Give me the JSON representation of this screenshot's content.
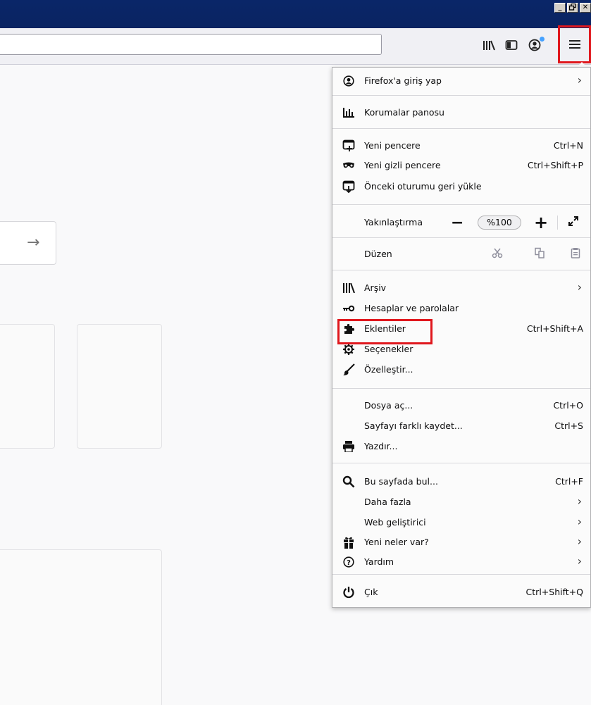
{
  "window": {
    "buttons": [
      "_",
      "🗗",
      "✕"
    ]
  },
  "toolbar": {
    "icons": [
      "library-icon",
      "sidebar-icon",
      "account-icon",
      "hamburger-menu-icon"
    ]
  },
  "menu": {
    "sign_in": "Firefox'a giriş yap",
    "protections": "Korumalar panosu",
    "new_window": "Yeni pencere",
    "new_window_sc": "Ctrl+N",
    "private_window": "Yeni gizli pencere",
    "private_window_sc": "Ctrl+Shift+P",
    "restore_session": "Önceki oturumu geri yükle",
    "zoom_label": "Yakınlaştırma",
    "zoom_minus": "−",
    "zoom_value": "%100",
    "zoom_plus": "+",
    "edit_label": "Düzen",
    "library": "Arşiv",
    "logins": "Hesaplar ve parolalar",
    "addons": "Eklentiler",
    "addons_sc": "Ctrl+Shift+A",
    "options": "Seçenekler",
    "customize": "Özelleştir...",
    "open_file": "Dosya aç...",
    "open_file_sc": "Ctrl+O",
    "save_page": "Sayfayı farklı kaydet...",
    "save_page_sc": "Ctrl+S",
    "print": "Yazdır...",
    "find": "Bu sayfada bul...",
    "find_sc": "Ctrl+F",
    "more": "Daha fazla",
    "web_dev": "Web geliştirici",
    "whats_new": "Yeni neler var?",
    "help": "Yardım",
    "quit": "Çık",
    "quit_sc": "Ctrl+Shift+Q",
    "chevron": "›"
  },
  "content": {
    "search_arrow": "→"
  },
  "colors": {
    "titlebar": "#0a2668",
    "highlight": "#e0171d",
    "notification_dot": "#45a1ff"
  }
}
